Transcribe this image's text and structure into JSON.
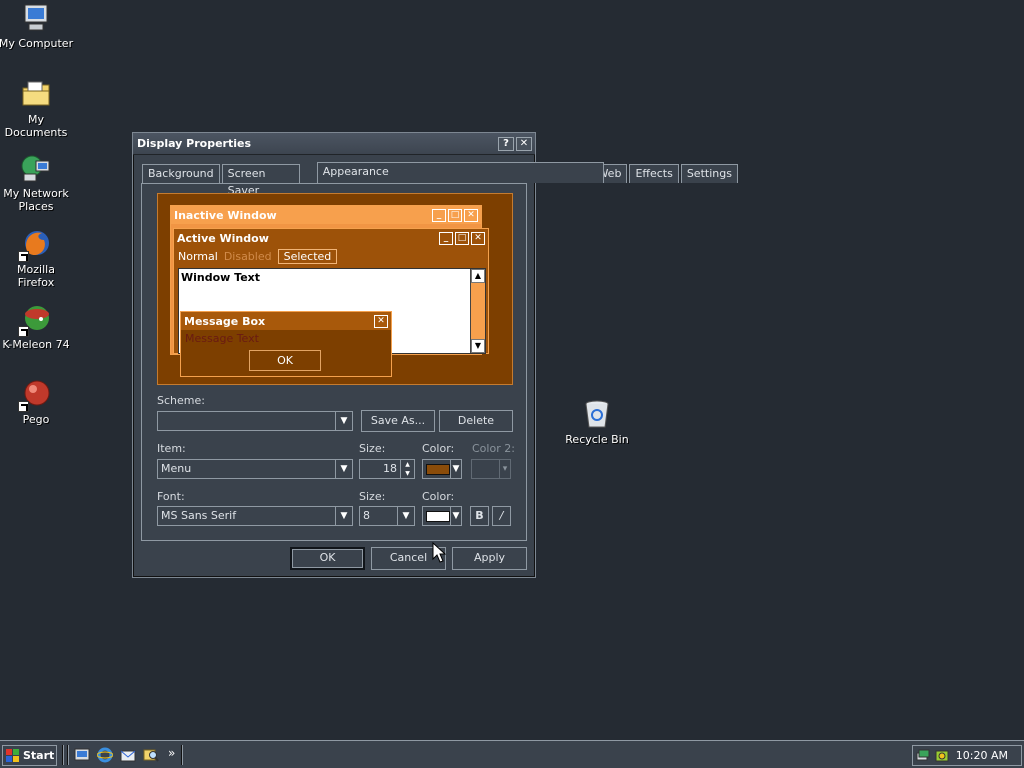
{
  "desktop": {
    "icons": [
      {
        "label": "My Computer"
      },
      {
        "label": "My Documents"
      },
      {
        "label": "My Network Places"
      },
      {
        "label": "Mozilla Firefox"
      },
      {
        "label": "K-Meleon 74"
      },
      {
        "label": "Pego"
      },
      {
        "label": "Recycle Bin"
      }
    ]
  },
  "window": {
    "title": "Display Properties",
    "help_label": "?",
    "close_label": "✕",
    "tabs": [
      "Background",
      "Screen Saver",
      "Appearance",
      "Web",
      "Effects",
      "Settings"
    ],
    "active_tab": "Appearance"
  },
  "preview": {
    "inactive_title": "Inactive Window",
    "active_title": "Active Window",
    "menu_normal": "Normal",
    "menu_disabled": "Disabled",
    "menu_selected": "Selected",
    "window_text": "Window Text",
    "msgbox_title": "Message Box",
    "msgbox_text": "Message Text",
    "msgbox_ok": "OK"
  },
  "form": {
    "scheme_label": "Scheme:",
    "scheme_value": "",
    "save_as_label": "Save As...",
    "delete_label": "Delete",
    "item_label": "Item:",
    "item_value": "Menu",
    "item_size_label": "Size:",
    "item_size_value": "18",
    "item_color_label": "Color:",
    "item_color_value": "#8a4c0a",
    "item_color2_label": "Color 2:",
    "font_label": "Font:",
    "font_value": "MS Sans Serif",
    "font_size_label": "Size:",
    "font_size_value": "8",
    "font_color_label": "Color:",
    "font_color_value": "#ffffff",
    "bold_label": "B",
    "italic_label": "/"
  },
  "dialog_buttons": {
    "ok": "OK",
    "cancel": "Cancel",
    "apply": "Apply"
  },
  "taskbar": {
    "start_label": "Start",
    "chevron": "»",
    "clock": "10:20 AM"
  }
}
